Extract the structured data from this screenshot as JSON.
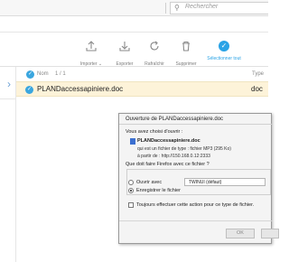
{
  "browser": {
    "search_placeholder": "Rechercher",
    "search_icon": "magnifier-icon"
  },
  "toolbar": {
    "items": [
      {
        "label": "Importer",
        "icon": "import-icon"
      },
      {
        "label": "Exporter",
        "icon": "export-icon"
      },
      {
        "label": "Rafraîchir",
        "icon": "refresh-icon"
      },
      {
        "label": "Supprimer",
        "icon": "trash-icon"
      },
      {
        "label": "Sélectionner tout",
        "icon": "check-circle-icon"
      }
    ],
    "accent": "#2aa3e6"
  },
  "list": {
    "header": {
      "name": "Nom",
      "count": "1 / 1",
      "type": "Type"
    },
    "rows": [
      {
        "name": "PLANDaccessapiniere.doc",
        "type": "doc",
        "selected": true
      }
    ],
    "selected_color": "#fdf3d9"
  },
  "dialog": {
    "title": "Ouverture de PLANDaccessapiniere.doc",
    "intro": "Vous avez choisi d'ouvrir :",
    "file_name": "PLANDaccessapiniere.doc",
    "file_type": "qui est un fichier de type : fichier MP3 (295 Ko)",
    "file_source": "à partir de : http://150.168.0.12:2333",
    "question": "Que doit faire Firefox avec ce fichier ?",
    "open_with_label": "Ouvrir avec",
    "open_with_value": "TWINUI (défaut)",
    "save_label": "Enregistrer le fichier",
    "selected_option": "save",
    "always_label": "Toujours effectuer cette action pour ce type de fichier.",
    "ok_label": "OK"
  }
}
